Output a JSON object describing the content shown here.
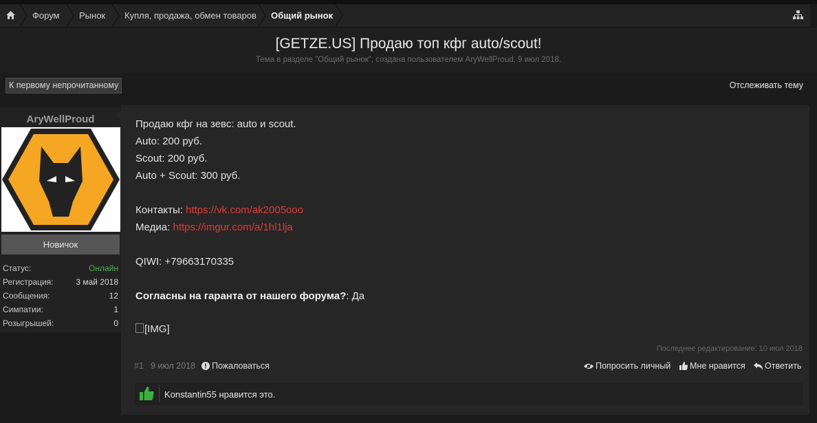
{
  "breadcrumb": {
    "items": [
      "Форум",
      "Рынок",
      "Купля, продажа, обмен товаров",
      "Общий рынок"
    ]
  },
  "icons": {
    "home": "home-icon",
    "sitemap": "sitemap-icon",
    "like": "thumbs-up-icon",
    "report": "exclamation-circle-icon",
    "private": "eye-icon",
    "thumb": "thumbs-up-icon",
    "reply": "reply-icon"
  },
  "colors": {
    "link": "#e53935",
    "online": "#4caf50",
    "like_green": "#3fae3f",
    "avatar_orange": "#f5a623"
  },
  "thread": {
    "title": "[GETZE.US] Продаю топ кфг auto/scout!",
    "subtitle": "Тема в разделе \"Общий рынок\", создана пользователем AryWellProud, 9 июл 2018."
  },
  "actions": {
    "unread": "К первому непрочитанному",
    "watch": "Отслеживать тему"
  },
  "user": {
    "name": "AryWellProud",
    "rank": "Новичок",
    "stats": [
      {
        "label": "Статус:",
        "value": "Онлайн"
      },
      {
        "label": "Регистрация:",
        "value": "3 май 2018"
      },
      {
        "label": "Сообщения:",
        "value": "12"
      },
      {
        "label": "Симпатии:",
        "value": "1"
      },
      {
        "label": "Розыгрышей:",
        "value": "0"
      }
    ]
  },
  "post": {
    "line1": "Продаю кфг на зевс: auto и scout.",
    "line2": "Auto: 200 руб.",
    "line3": "Scout: 200 руб.",
    "line4": "Auto + Scout: 300 руб.",
    "contacts_label": "Контакты: ",
    "contacts_link": "https://vk.com/ak2005ooo",
    "media_label": "Медиа: ",
    "media_link": "https://imgur.com/a/1hl1lja",
    "qiwi": "QIWI: +79663170335",
    "guarantee_q": "Согласны на гаранта от нашего форума?",
    "guarantee_a": ": Да",
    "img_alt": "[IMG]",
    "edited": "Последнее редактирование: 10 июл 2018",
    "number": "#1",
    "date": "9 июл 2018",
    "report": "Пожаловаться",
    "private": "Попросить личный",
    "like": "Мне нравится",
    "reply": "Ответить",
    "likes_text": "Konstantin55 нравится это."
  }
}
